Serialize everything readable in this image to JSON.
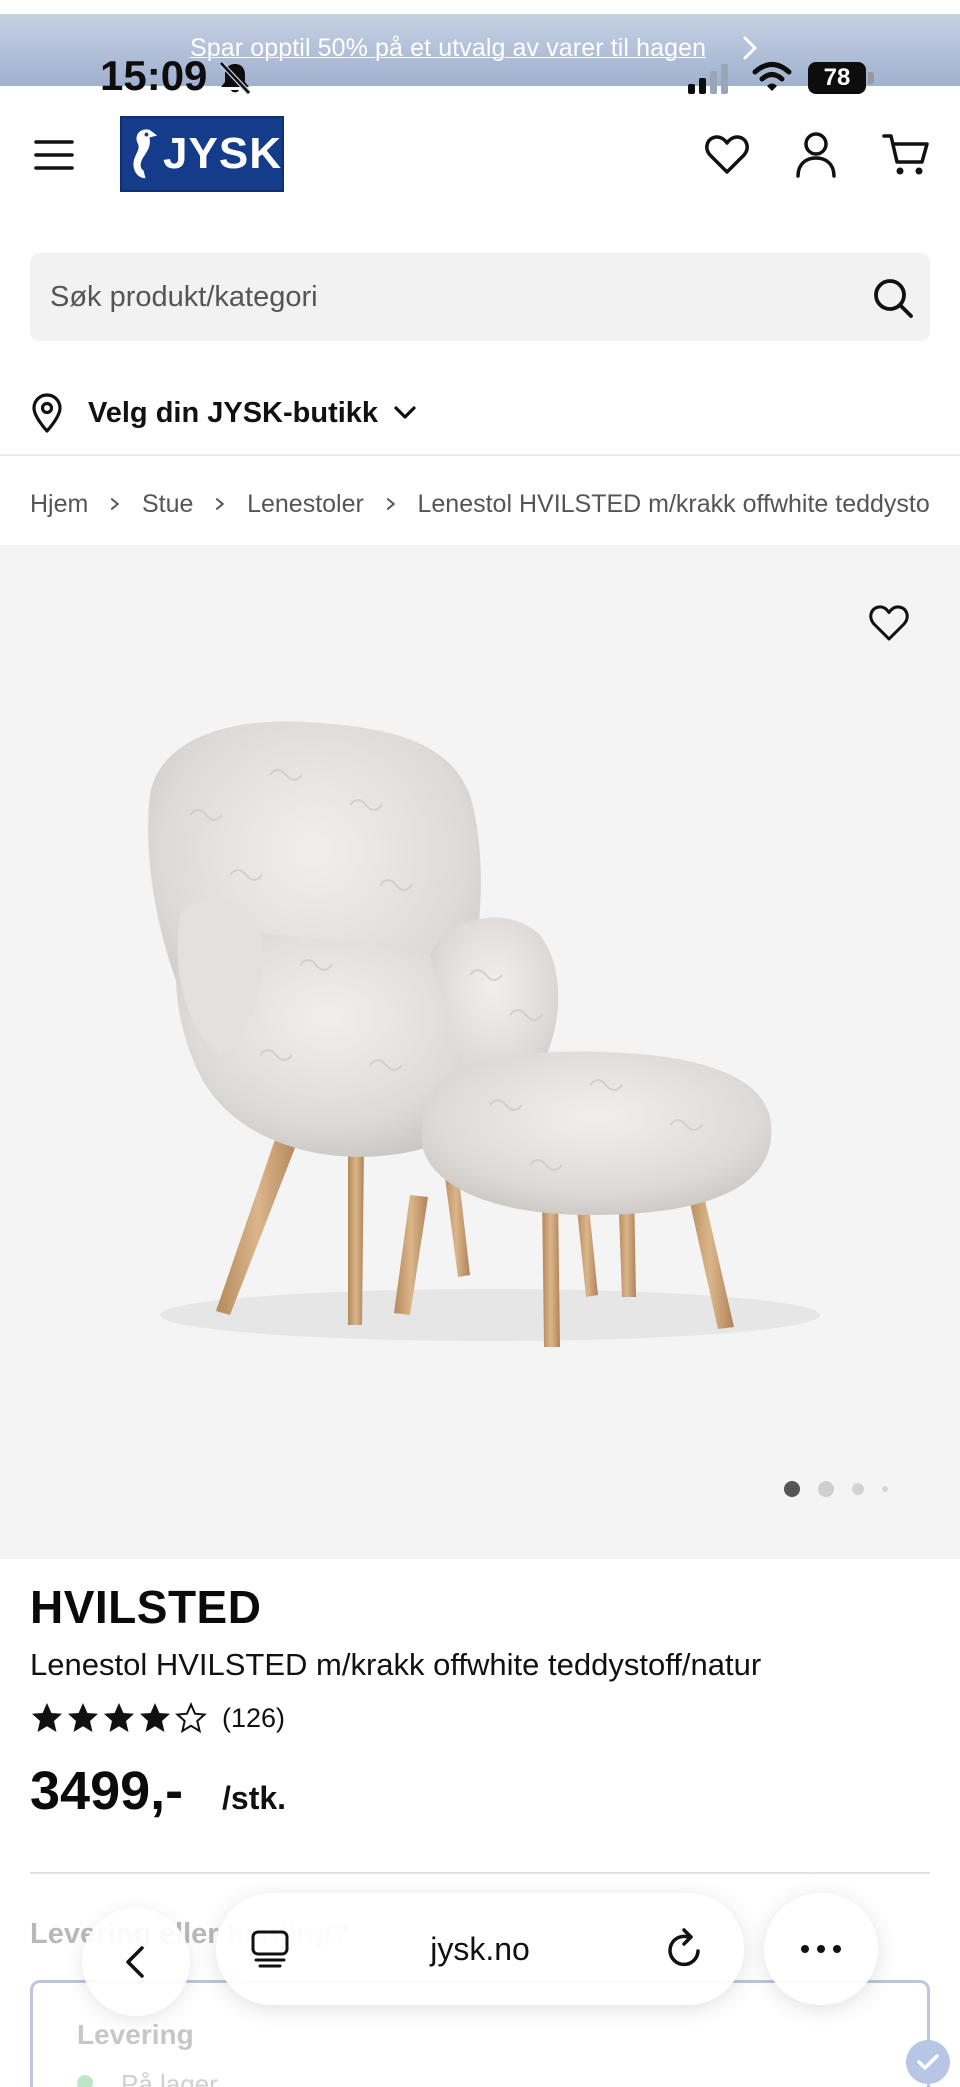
{
  "promo": {
    "text": "Spar opptil 50% på et utvalg av varer til hagen"
  },
  "status_bar": {
    "time": "15:09",
    "battery": "78"
  },
  "header": {
    "logo_text": "JYSK"
  },
  "search": {
    "placeholder": "Søk produkt/kategori"
  },
  "store": {
    "label": "Velg din JYSK-butikk"
  },
  "breadcrumb": [
    "Hjem",
    "Stue",
    "Lenestoler",
    "Lenestol HVILSTED m/krakk offwhite teddystoff"
  ],
  "gallery": {
    "slides_visible": 4,
    "active_slide": 1
  },
  "product": {
    "brand": "HVILSTED",
    "name": "Lenestol HVILSTED m/krakk offwhite teddystoff/natur",
    "rating_stars": 4,
    "rating_max": 5,
    "review_count": "(126)",
    "price": "3499,-",
    "unit": "/stk."
  },
  "delivery": {
    "heading": "Levering eller henting?",
    "option": "Levering",
    "stock": "På lager"
  },
  "browser": {
    "url": "jysk.no"
  },
  "colors": {
    "brand_blue": "#143c8a",
    "gallery_bg": "#f4f4f4",
    "text": "#111111"
  }
}
